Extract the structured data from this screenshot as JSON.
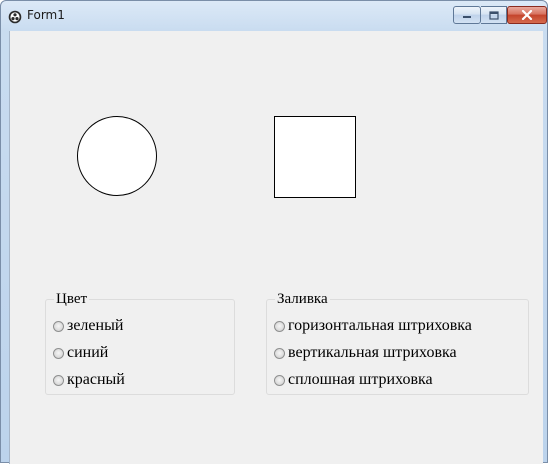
{
  "window": {
    "title": "Form1",
    "icon": "app-icon"
  },
  "titlebar_buttons": {
    "minimize_icon": "minimize-icon",
    "maximize_icon": "maximize-icon",
    "close_icon": "close-icon"
  },
  "shapes": {
    "circle_fill": "#ffffff",
    "square_fill": "#ffffff"
  },
  "color_group": {
    "title": "Цвет",
    "options": [
      "зеленый",
      "синий",
      "красный"
    ]
  },
  "fill_group": {
    "title": "Заливка",
    "options": [
      "горизонтальная штриховка",
      "вертикальная штриховка",
      "сплошная штриховка"
    ]
  }
}
